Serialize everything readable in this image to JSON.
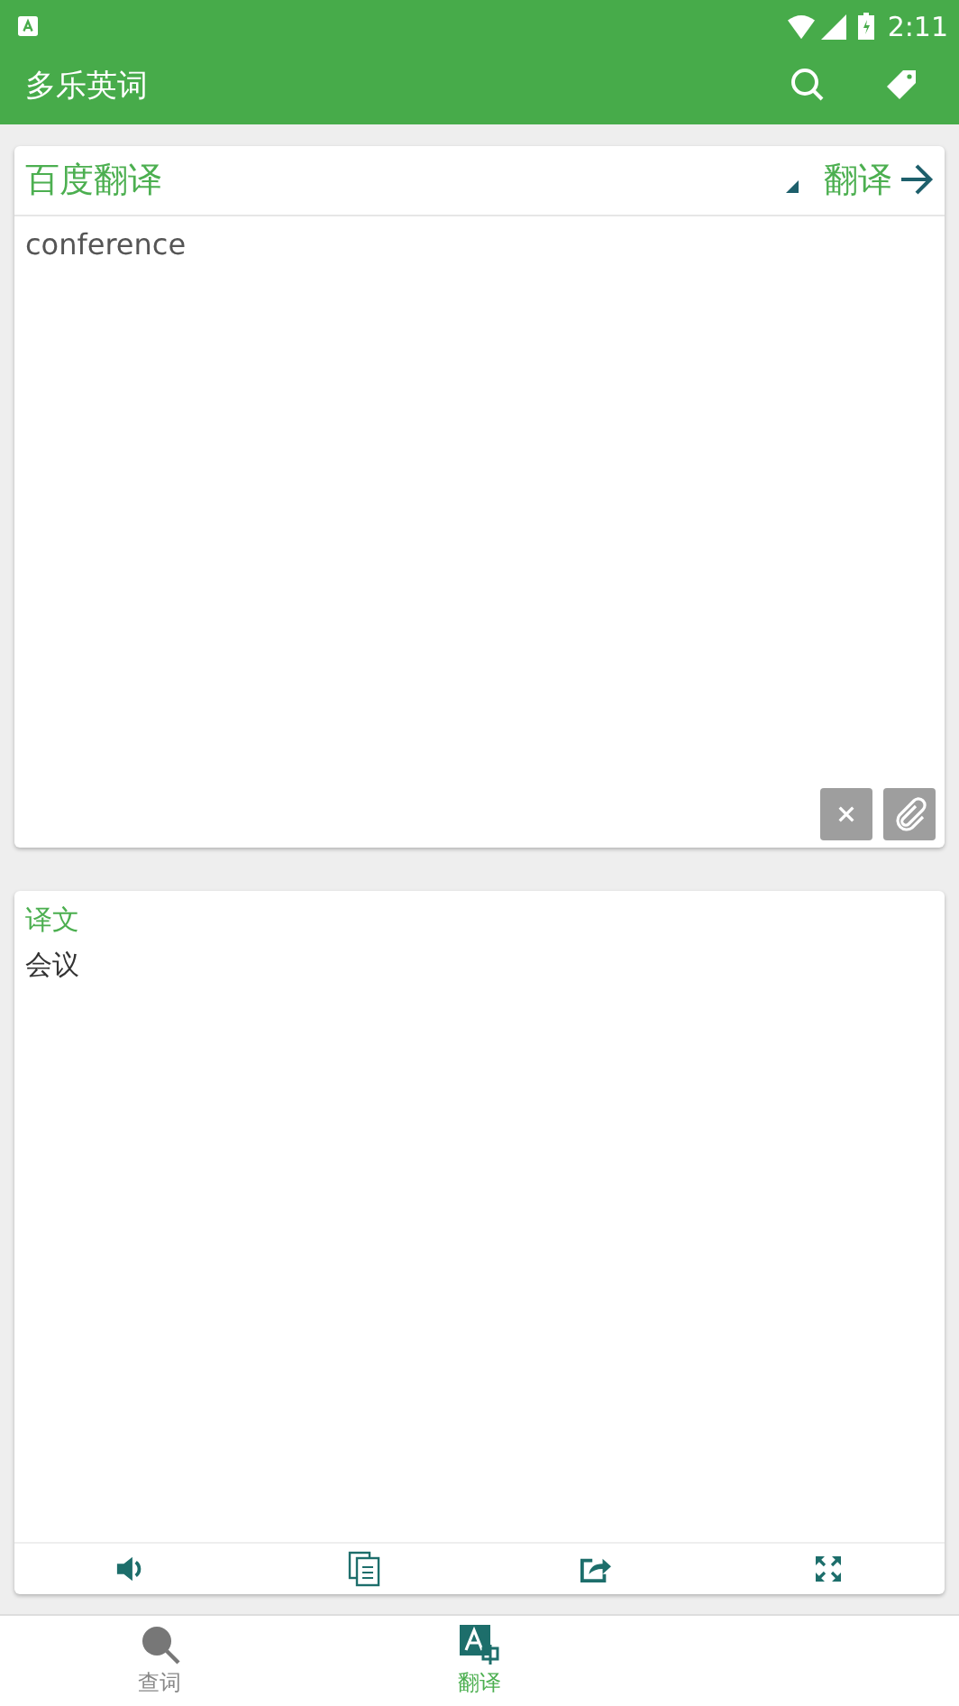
{
  "status_bar": {
    "time": "2:11"
  },
  "app_bar": {
    "title": "多乐英词"
  },
  "input_card": {
    "engine": "百度翻译",
    "translate_button": "翻译",
    "text": "conference"
  },
  "output_card": {
    "heading": "译文",
    "text": "会议"
  },
  "bottom_nav": [
    {
      "label": "查词",
      "kind": "search",
      "selected": false
    },
    {
      "label": "翻译",
      "kind": "translate",
      "selected": true
    }
  ]
}
